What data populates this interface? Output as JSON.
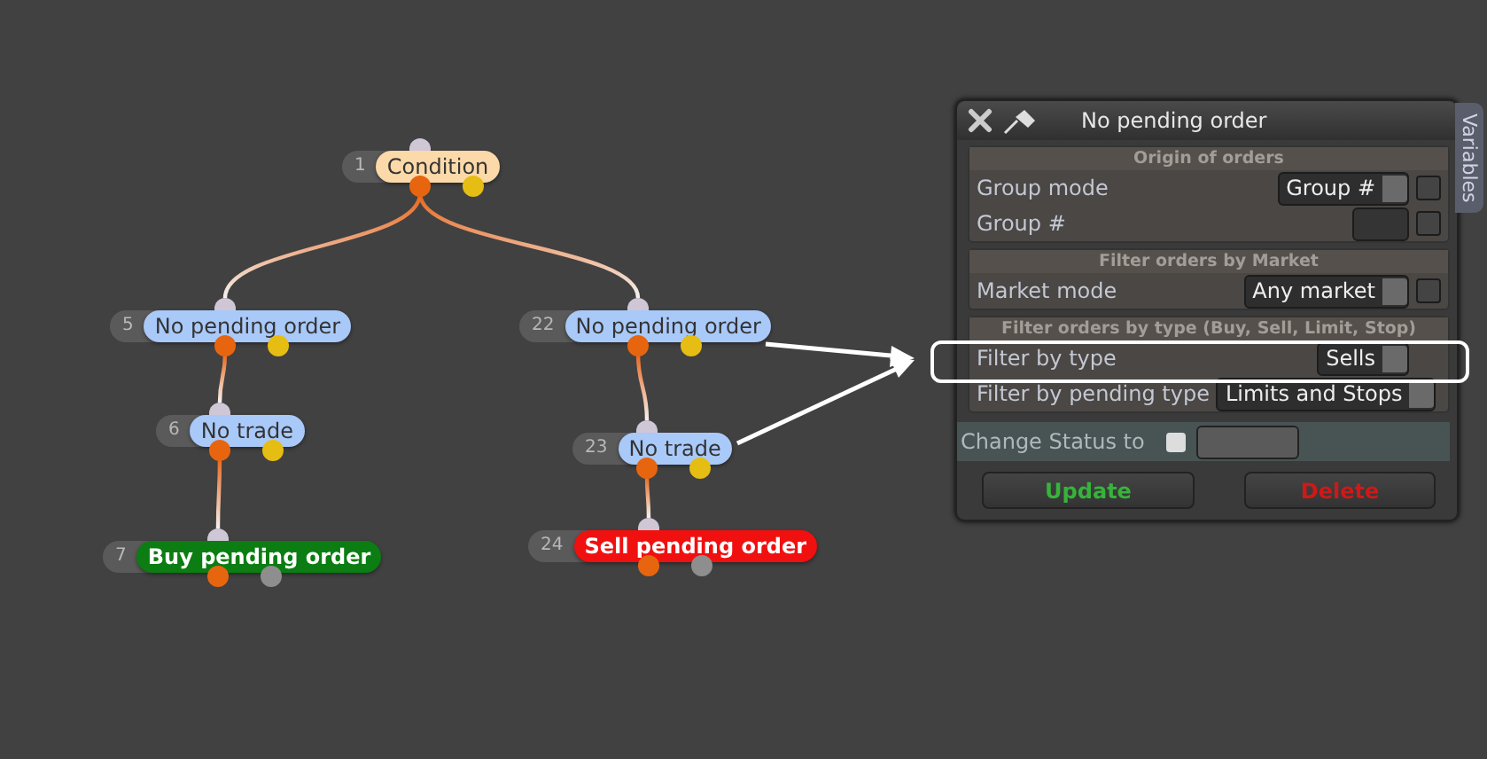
{
  "tree": {
    "number": "1",
    "label": "Condition",
    "kind": "check",
    "color": "#fcd9a8",
    "children": [
      {
        "number": "5",
        "label": "No pending order",
        "kind": "check",
        "color": "#a9c9f9",
        "children": [
          {
            "number": "6",
            "label": "No trade",
            "kind": "check",
            "color": "#a9c9f9",
            "children": [
              {
                "number": "7",
                "label": "Buy pending order",
                "kind": "order",
                "color": "#0b7d12"
              }
            ]
          }
        ]
      },
      {
        "number": "22",
        "label": "No pending order",
        "kind": "check",
        "color": "#a9c9f9",
        "children": [
          {
            "number": "23",
            "label": "No trade",
            "kind": "check",
            "color": "#a9c9f9",
            "children": [
              {
                "number": "24",
                "label": "Sell pending order",
                "kind": "order",
                "color": "#f01010"
              }
            ]
          }
        ]
      }
    ]
  },
  "panel": {
    "title": "No pending order",
    "side_tab": "Variables",
    "sections": [
      {
        "title": "Origin of orders",
        "rows": [
          {
            "kind": "dropdown",
            "label": "Group mode",
            "value": "Group #",
            "checked": false
          },
          {
            "kind": "input",
            "label": "Group #",
            "checked": false
          }
        ]
      },
      {
        "title": "Filter orders by Market",
        "rows": [
          {
            "kind": "dropdown",
            "label": "Market mode",
            "value": "Any market",
            "checked": false
          }
        ]
      },
      {
        "title": "Filter orders by type (Buy, Sell, Limit, Stop)",
        "rows": [
          {
            "kind": "dropdown",
            "label": "Filter by type",
            "value": "Sells",
            "highlighted": true
          },
          {
            "kind": "dropdown",
            "label": "Filter by pending type",
            "value": "Limits and Stops"
          }
        ]
      }
    ],
    "status": {
      "label": "Change Status to",
      "checked": false
    },
    "buttons": [
      {
        "label": "Update",
        "kind": "confirm"
      },
      {
        "label": "Delete",
        "kind": "danger"
      }
    ]
  }
}
